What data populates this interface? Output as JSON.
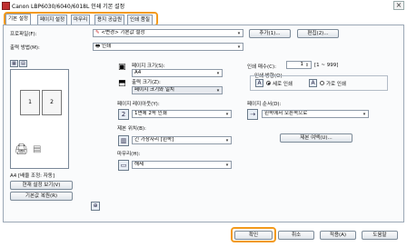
{
  "window": {
    "title": "Canon LBP6030/6040/6018L 인쇄 기본 설정",
    "close_glyph": "×"
  },
  "tabs": [
    {
      "label": "기본 설정"
    },
    {
      "label": "페이지 설정"
    },
    {
      "label": "마무리"
    },
    {
      "label": "용지 공급원"
    },
    {
      "label": "인쇄 품질"
    }
  ],
  "profile": {
    "label": "프로파일(F):",
    "value": "<변경> 기본값 설정",
    "add_label": "추가(1)...",
    "edit_label": "편집(2)..."
  },
  "output": {
    "label": "출력 방법(M):",
    "value": "인쇄"
  },
  "preview": {
    "page1": "1",
    "page2": "2",
    "caption": "A4 [배율 조정: 자동]",
    "view_settings_label": "현재 설정 보기(V)",
    "restore_defaults_label": "기본값 복원(R)"
  },
  "page_size": {
    "label": "페이지 크기(S):",
    "value": "A4"
  },
  "output_size": {
    "label": "출력 크기(Z):",
    "value": "페이지 크기와 일치"
  },
  "copies": {
    "label": "인쇄 매수(C):",
    "value": "1",
    "range": "[1 ~ 999]"
  },
  "orientation": {
    "label": "인쇄 방향(O)",
    "portrait_icon": "A",
    "portrait_label": "세로 인쇄",
    "landscape_icon": "A",
    "landscape_label": "가로 인쇄",
    "selected": "portrait"
  },
  "layout": {
    "label": "페이지 레이아웃(Y):",
    "icon": "2",
    "value": "1면에 2쪽 인쇄"
  },
  "page_order": {
    "label": "페이지 순서(D):",
    "value": "왼쪽에서 오른쪽으로"
  },
  "binding": {
    "label": "제본 위치(B):",
    "value": "긴 가장자리 [왼쪽]",
    "margin_button_label": "제본 여백(U)..."
  },
  "finishing": {
    "label": "마무리(H):",
    "value": "해제"
  },
  "footer": {
    "ok_label": "확인",
    "cancel_label": "취소",
    "apply_label": "적용(A)",
    "help_label": "도움말"
  },
  "colors": {
    "highlight": "#f39a1c",
    "panel_border": "#9aa7b5",
    "dialog_bg": "#ffffff"
  }
}
